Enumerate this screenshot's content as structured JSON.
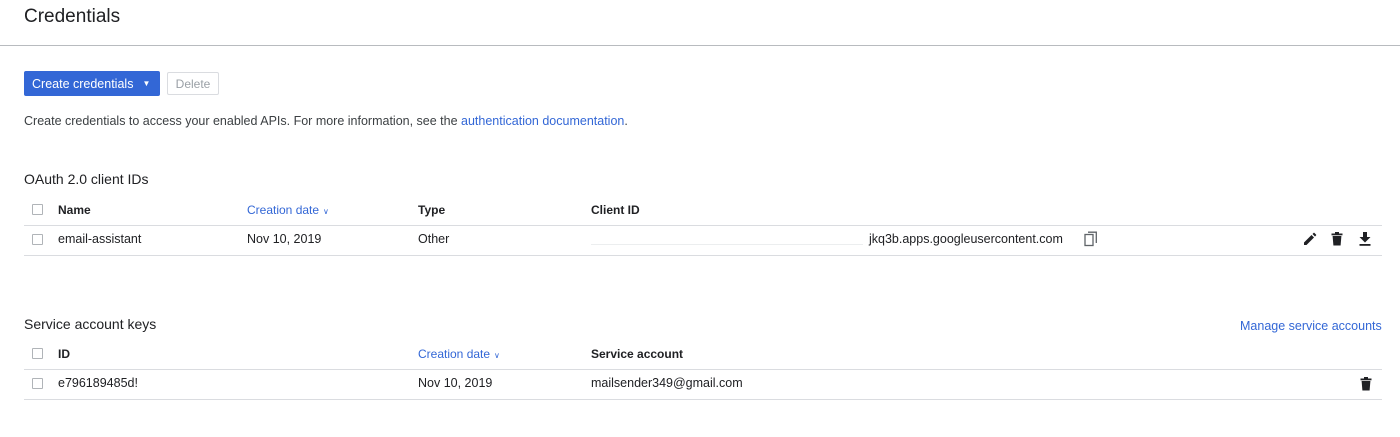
{
  "page": {
    "title": "Credentials"
  },
  "toolbar": {
    "create_label": "Create credentials",
    "delete_label": "Delete"
  },
  "info": {
    "text": "Create credentials to access your enabled APIs. For more information, see the ",
    "link_text": "authentication documentation",
    "suffix": "."
  },
  "oauth": {
    "title": "OAuth 2.0 client IDs",
    "headers": {
      "name": "Name",
      "creation_date": "Creation date",
      "type": "Type",
      "client_id": "Client ID"
    },
    "rows": [
      {
        "name": "email-assistant",
        "creation_date": "Nov 10, 2019",
        "type": "Other",
        "client_id": "jkq3b.apps.googleusercontent.com"
      }
    ],
    "row_icons": [
      "copy-icon",
      "edit-icon",
      "delete-icon",
      "download-icon"
    ]
  },
  "service": {
    "title": "Service account keys",
    "manage_link": "Manage service accounts",
    "headers": {
      "id": "ID",
      "creation_date": "Creation date",
      "service_account": "Service account"
    },
    "rows": [
      {
        "id": "e796189485d!",
        "creation_date": "Nov 10, 2019",
        "service_account": "mailsender349@gmail.com"
      }
    ],
    "row_icons": [
      "delete-icon"
    ]
  },
  "colors": {
    "accent": "#3367d6",
    "divider": "#dadce0"
  }
}
